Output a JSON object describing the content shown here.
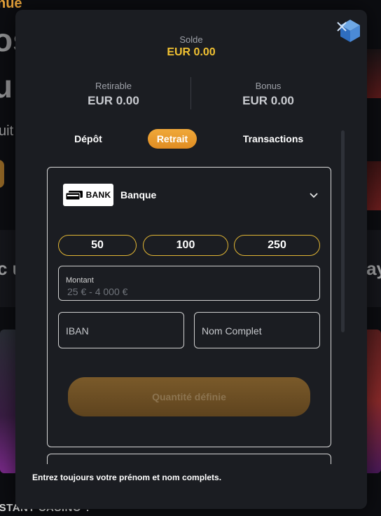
{
  "background": {
    "top_text": "nue",
    "big_line_1": "os",
    "big_line_2": "u",
    "small_text": "uit",
    "band_text": "c u",
    "band_text_right": "Pay",
    "bottom_text": "ISTANT CASINO ?"
  },
  "wallet": {
    "balance_label": "Solde",
    "balance_value": "EUR 0.00",
    "withdrawable_label": "Retirable",
    "withdrawable_value": "EUR 0.00",
    "bonus_label": "Bonus",
    "bonus_value": "EUR 0.00"
  },
  "tabs": {
    "deposit": "Dépôt",
    "withdraw": "Retrait",
    "transactions": "Transactions",
    "active": "withdraw"
  },
  "method": {
    "logo_text": "BANK",
    "name": "Banque"
  },
  "amount_options": [
    "50",
    "100",
    "250"
  ],
  "form": {
    "amount_label": "Montant",
    "amount_placeholder": "25 € - 4 000 €",
    "iban_placeholder": "IBAN",
    "fullname_placeholder": "Nom Complet",
    "submit_label": "Quantité définie"
  },
  "footer_note": "Entrez toujours votre prénom et nom complets.",
  "colors": {
    "accent": "#f0a93a",
    "balance_yellow": "#f2c232",
    "modal_bg": "#1b1d22",
    "amount_border": "#e0b534"
  },
  "icons": {
    "logo": "cube-logo-icon",
    "chevron": "chevron-down-icon",
    "bank": "bank-card-icon"
  }
}
